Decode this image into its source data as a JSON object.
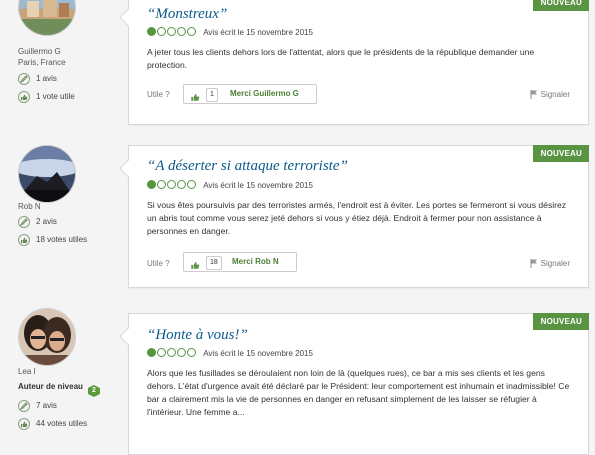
{
  "reviews": [
    {
      "user": {
        "name": "Guillermo G",
        "location": "Paris, France",
        "stats": [
          {
            "icon": "pencil-icon",
            "text": "1 avis"
          },
          {
            "icon": "thumbs-up-icon",
            "text": "1 vote utile"
          }
        ]
      },
      "badge": "NOUVEAU",
      "title": "“Monstreux”",
      "rating_date": "Avis écrit le 15 novembre 2015",
      "rating_bubbles": 1,
      "body": "A jeter tous les clients dehors lors de l'attentat, alors que le présidents de la république demander une protection.",
      "utile_label": "Utile ?",
      "vote_count": "1",
      "thanks_label": "Merci Guillermo G",
      "report_label": "Signaler"
    },
    {
      "user": {
        "name": "Rob N",
        "stats": [
          {
            "icon": "pencil-icon",
            "text": "2 avis"
          },
          {
            "icon": "thumbs-up-icon",
            "text": "18 votes utiles"
          }
        ]
      },
      "badge": "NOUVEAU",
      "title": "“A déserter si attaque terroriste”",
      "rating_date": "Avis écrit le 15 novembre 2015",
      "rating_bubbles": 1,
      "body": "Si vous êtes poursuivis par des terroristes armés, l'endroit est à éviter. Les portes se fermeront si vous désirez un abris tout comme vous serez jeté dehors si vous y étiez déjà. Endroit à fermer pour non assistance à personnes en danger.",
      "utile_label": "Utile ?",
      "vote_count": "18",
      "thanks_label": "Merci Rob N",
      "report_label": "Signaler"
    },
    {
      "user": {
        "name": "Lea l",
        "level_label": "Auteur de niveau",
        "level_value": "2",
        "stats": [
          {
            "icon": "pencil-icon",
            "text": "7 avis"
          },
          {
            "icon": "thumbs-up-icon",
            "text": "44 votes utiles"
          }
        ]
      },
      "badge": "NOUVEAU",
      "title": "“Honte à vous!”",
      "rating_date": "Avis écrit le 15 novembre 2015",
      "rating_bubbles": 1,
      "body": "Alors que les fusillades se déroulaient non loin de là (quelques rues), ce bar a mis ses clients et les gens dehors. L'état d'urgence avait été déclaré par le Président: leur comportement est inhumain et inadmissible! Ce bar a clairement mis la vie de personnes en danger en refusant simplement de les laisser se réfugier à l'intérieur. Une femme a..."
    }
  ],
  "colors": {
    "accent_green": "#589442",
    "title_blue": "#0b5a8c"
  }
}
